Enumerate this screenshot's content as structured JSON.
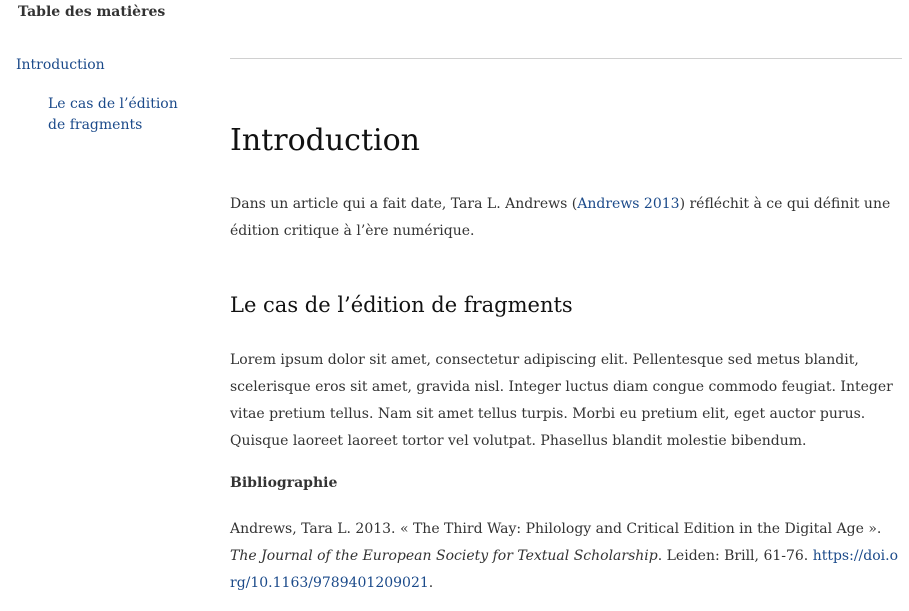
{
  "toc": {
    "title": "Table des matières",
    "items": [
      {
        "label": "Introduction"
      },
      {
        "label": "Le cas de l’édition de fragments"
      }
    ]
  },
  "colors": {
    "link": "#1b4a8a",
    "text": "#333333",
    "rule": "#d0d0d0"
  },
  "article": {
    "heading": "Introduction",
    "intro": {
      "before": "Dans un article qui a fait date, Tara L. Andrews (",
      "citation": "Andrews 2013",
      "after": ") réfléchit à ce qui définit une édition critique à l’ère numérique."
    },
    "section_heading": "Le cas de l’édition de fragments",
    "lorem": "Lorem ipsum dolor sit amet, consectetur adipiscing elit. Pellentesque sed metus blandit, scelerisque eros sit amet, gravida nisl. Integer luctus diam congue commodo feugiat. Integer vitae pretium tellus. Nam sit amet tellus turpis. Morbi eu pretium elit, eget auctor purus. Quisque laoreet laoreet tortor vel volutpat. Phasellus blandit molestie bibendum.",
    "bibliography": {
      "heading": "Bibliographie",
      "entry": {
        "authors_year": "Andrews, Tara L. 2013. « The Third Way: Philology and Critical Edition in the Digital Age ». ",
        "journal": "The Journal of the European Society for Textual Scholarship",
        "publisher": ". Leiden: Brill, 61-76. ",
        "doi": "https://doi.org/10.1163/9789401209021",
        "end": "."
      }
    }
  }
}
